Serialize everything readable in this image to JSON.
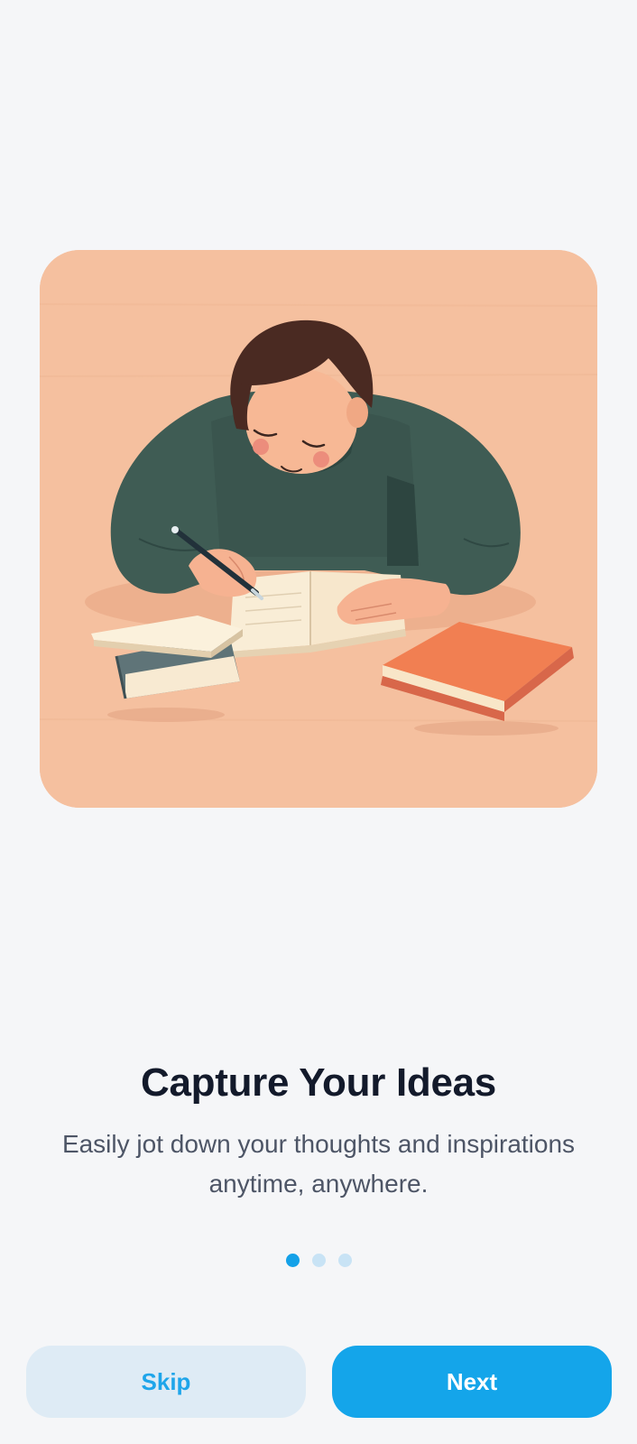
{
  "onboarding": {
    "illustration": "person-writing-in-notebook-illustration",
    "title": "Capture Your Ideas",
    "description": "Easily jot down your thoughts and inspirations anytime, anywhere.",
    "page_indicator": {
      "current": 1,
      "total": 3
    }
  },
  "actions": {
    "skip_label": "Skip",
    "next_label": "Next"
  },
  "colors": {
    "background": "#f5f6f8",
    "accent": "#14a5ea",
    "skip_bg": "#deebf5",
    "card_bg": "#f5c09f"
  }
}
